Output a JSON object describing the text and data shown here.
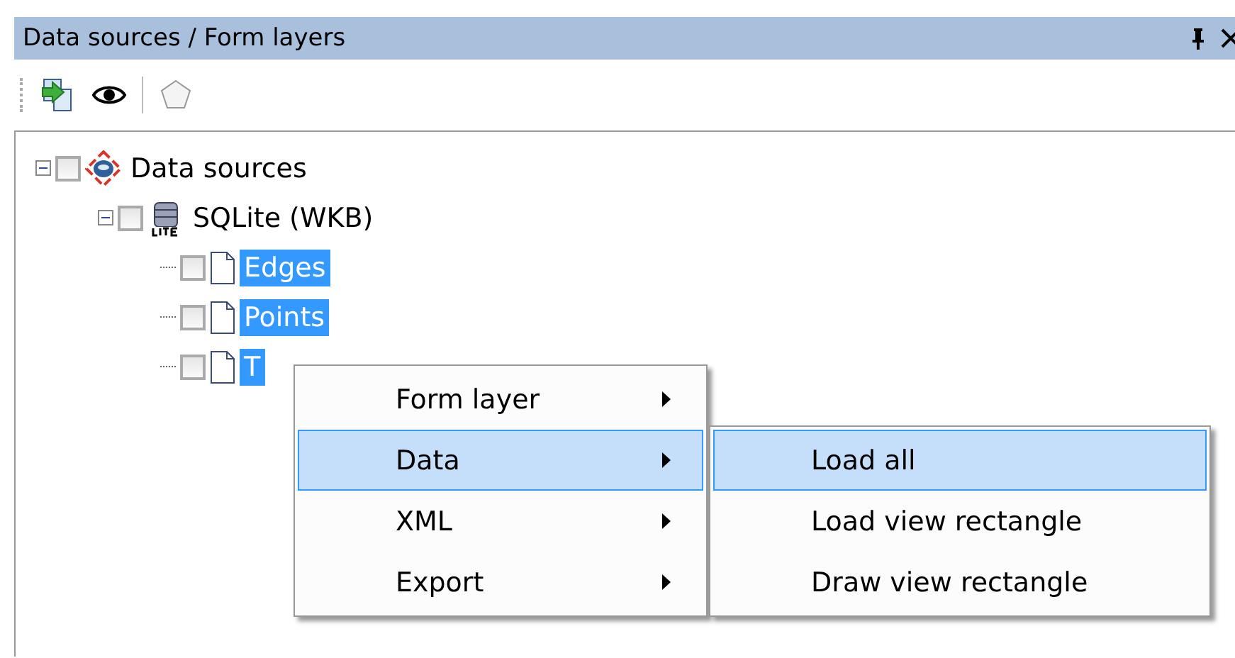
{
  "panel": {
    "title": "Data sources / Form layers"
  },
  "toolbar": [
    {
      "kind": "load"
    },
    {
      "kind": "view"
    },
    {
      "kind": "separator"
    },
    {
      "kind": "polygon"
    }
  ],
  "tree": [
    {
      "label": "Data sources",
      "kind": "root",
      "checked": false,
      "expanded": true,
      "selected": false,
      "children": [
        {
          "label": "SQLite (WKB)",
          "kind": "database",
          "checked": false,
          "expanded": true,
          "selected": false,
          "children": [
            {
              "label": "Edges",
              "kind": "layer",
              "checked": false,
              "selected": true
            },
            {
              "label": "Points",
              "kind": "layer",
              "checked": false,
              "selected": true
            },
            {
              "label": "T",
              "kind": "layer",
              "checked": false,
              "selected": true
            }
          ]
        }
      ]
    }
  ],
  "context_menu": {
    "items": [
      {
        "label": "Form layer",
        "selected": false,
        "submenu": true
      },
      {
        "label": "Data",
        "selected": true,
        "submenu": true
      },
      {
        "label": "XML",
        "selected": false,
        "submenu": true
      },
      {
        "label": "Export",
        "selected": false,
        "submenu": true
      }
    ]
  },
  "submenu": {
    "items": [
      {
        "label": "Load all",
        "selected": true
      },
      {
        "label": "Load view rectangle",
        "selected": false
      },
      {
        "label": "Draw view rectangle",
        "selected": false
      }
    ]
  }
}
